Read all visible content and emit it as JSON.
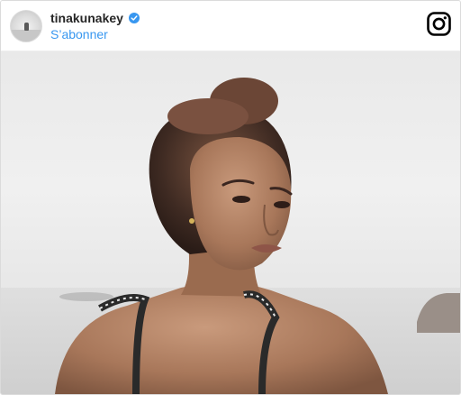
{
  "header": {
    "username": "tinakunakey",
    "subscribe_label": "S’abonner",
    "verified_icon": "verified-badge-icon",
    "app_icon": "instagram-icon",
    "accent_color": "#3897f0"
  },
  "photo": {
    "subject_icon": "photo-portrait"
  }
}
